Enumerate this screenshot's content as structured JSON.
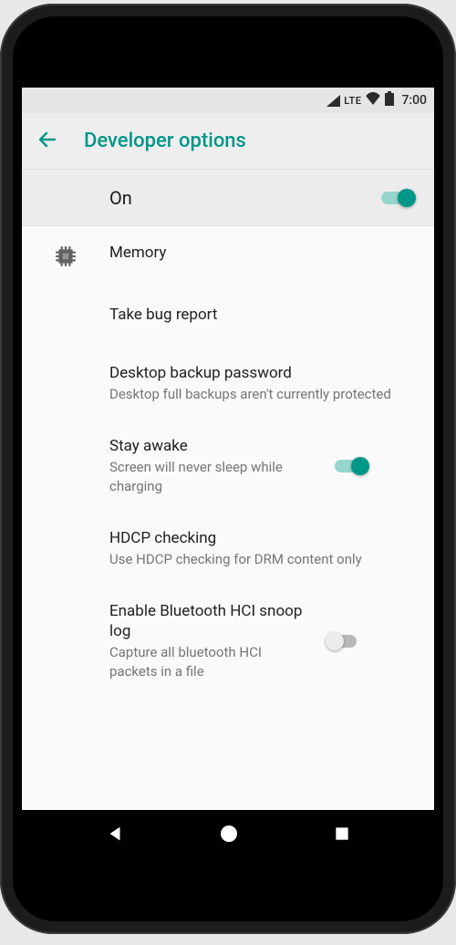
{
  "status": {
    "network_label": "LTE",
    "time": "7:00"
  },
  "header": {
    "title": "Developer options"
  },
  "master_toggle": {
    "label": "On",
    "enabled": true
  },
  "items": [
    {
      "id": "memory",
      "title": "Memory",
      "subtitle": null,
      "icon": "memory-chip-icon",
      "toggle": null
    },
    {
      "id": "bug-report",
      "title": "Take bug report",
      "subtitle": null,
      "icon": null,
      "toggle": null
    },
    {
      "id": "desktop-backup",
      "title": "Desktop backup password",
      "subtitle": "Desktop full backups aren't currently protected",
      "icon": null,
      "toggle": null
    },
    {
      "id": "stay-awake",
      "title": "Stay awake",
      "subtitle": "Screen will never sleep while charging",
      "icon": null,
      "toggle": true
    },
    {
      "id": "hdcp",
      "title": "HDCP checking",
      "subtitle": "Use HDCP checking for DRM content only",
      "icon": null,
      "toggle": null
    },
    {
      "id": "bt-hci",
      "title": "Enable Bluetooth HCI snoop log",
      "subtitle": "Capture all bluetooth HCI packets in a file",
      "icon": null,
      "toggle": false,
      "narrow": true
    }
  ],
  "colors": {
    "accent": "#009688"
  }
}
